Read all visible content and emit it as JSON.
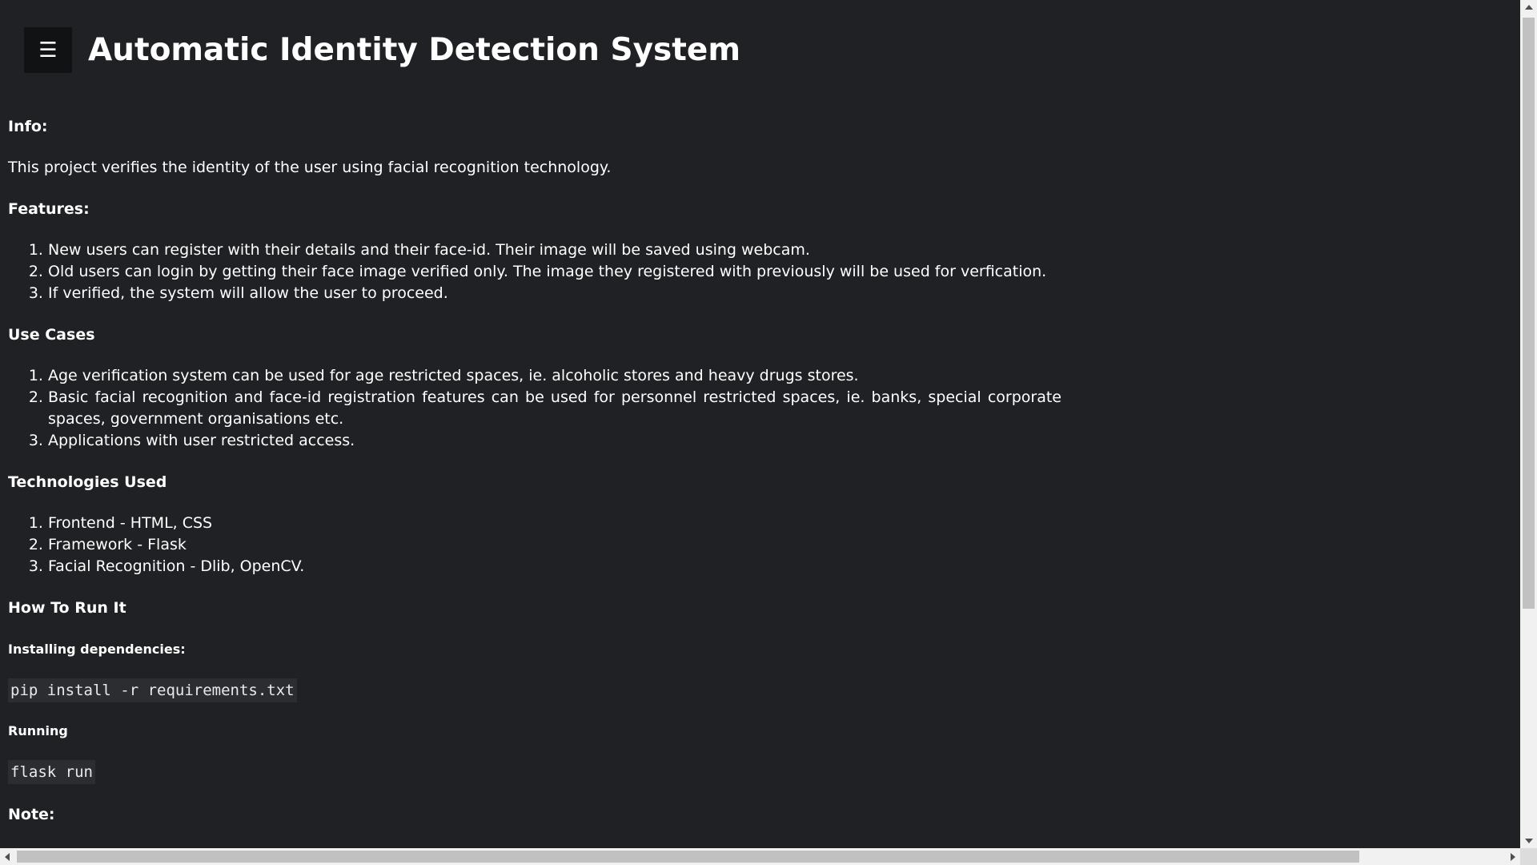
{
  "header": {
    "menu_icon": "☰",
    "title": "Automatic Identity Detection System"
  },
  "info": {
    "heading": "Info:",
    "text": "This project verifies the identity of the user using facial recognition technology."
  },
  "features": {
    "heading": "Features:",
    "items": [
      "New users can register with their details and their face-id. Their image will be saved using webcam.",
      "Old users can login by getting their face image verified only. The image they registered with previously will be used for verfication.",
      "If verified, the system will allow the user to proceed."
    ]
  },
  "use_cases": {
    "heading": "Use Cases",
    "items": [
      "Age verification system can be used for age restricted spaces, ie. alcoholic stores and heavy drugs stores.",
      "Basic facial recognition and face-id registration features can be used for personnel restricted spaces, ie. banks, special corporate spaces, government organisations etc.",
      "Applications with user restricted access."
    ]
  },
  "technologies": {
    "heading": "Technologies Used",
    "items": [
      "Frontend - HTML, CSS",
      "Framework - Flask",
      "Facial Recognition - Dlib, OpenCV."
    ]
  },
  "how_to_run": {
    "heading": "How To Run It",
    "install_heading": "Installing dependencies:",
    "install_cmd": "pip install -r requirements.txt",
    "run_heading": "Running",
    "run_cmd": "flask run"
  },
  "note": {
    "heading": "Note:"
  }
}
